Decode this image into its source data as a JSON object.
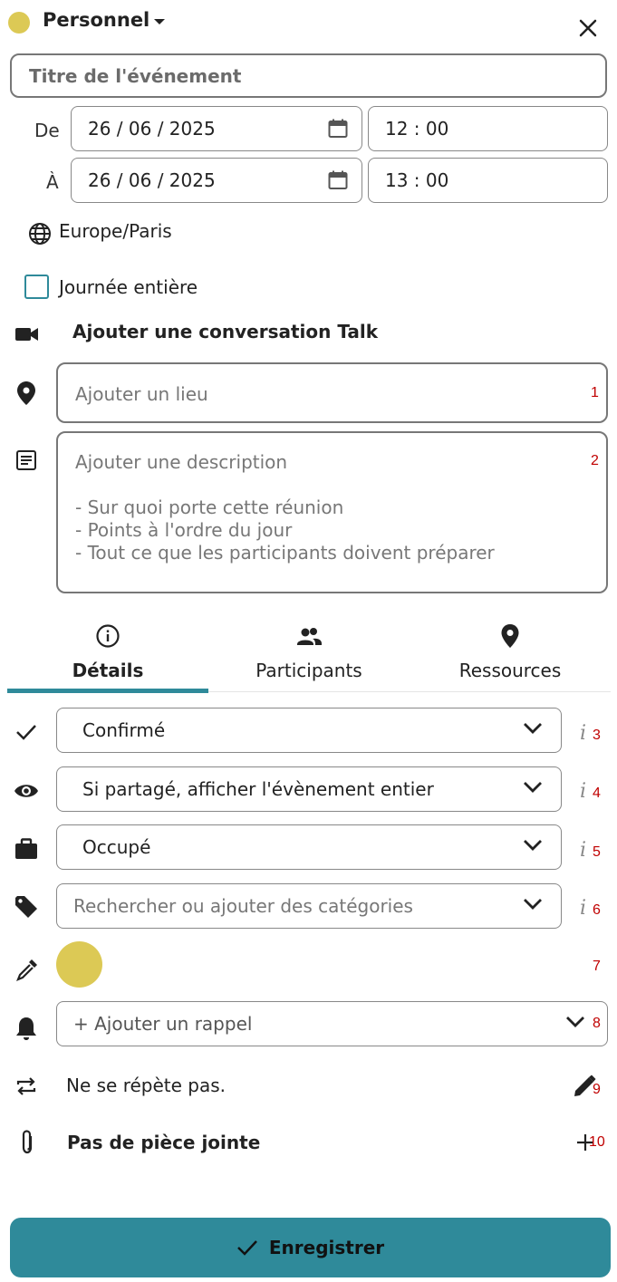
{
  "header": {
    "calendar_name": "Personnel",
    "calendar_color": "#dcc955"
  },
  "event": {
    "title_placeholder": "Titre de l'événement",
    "from_label": "De",
    "to_label": "À",
    "start_date": "26 / 06 / 2025",
    "start_time": "12 : 00",
    "end_date": "26 / 06 / 2025",
    "end_time": "13 : 00",
    "timezone": "Europe/Paris",
    "all_day_label": "Journée entière",
    "talk_label": "Ajouter une conversation Talk",
    "location_placeholder": "Ajouter un lieu",
    "description_placeholder_lines": [
      "Ajouter une description",
      "",
      "- Sur quoi porte cette réunion",
      "- Points à l'ordre du jour",
      "- Tout ce que les participants doivent préparer"
    ]
  },
  "tabs": [
    {
      "label": "Détails",
      "icon": "info-icon",
      "active": true
    },
    {
      "label": "Participants",
      "icon": "people-icon",
      "active": false
    },
    {
      "label": "Ressources",
      "icon": "location-pin-icon",
      "active": false
    }
  ],
  "details": {
    "status": "Confirmé",
    "visibility": "Si partagé, afficher l'évènement entier",
    "availability": "Occupé",
    "categories_placeholder": "Rechercher ou ajouter des catégories",
    "event_color": "#dcc955",
    "reminder_placeholder": "+ Ajouter un rappel",
    "repeat_text": "Ne se répète pas.",
    "attachment_text": "Pas de pièce jointe",
    "info_glyph": "i"
  },
  "annotations": [
    "1",
    "2",
    "3",
    "4",
    "5",
    "6",
    "7",
    "8",
    "9",
    "10"
  ],
  "footer": {
    "save_label": "Enregistrer",
    "accent_color": "#2f8a9a"
  }
}
